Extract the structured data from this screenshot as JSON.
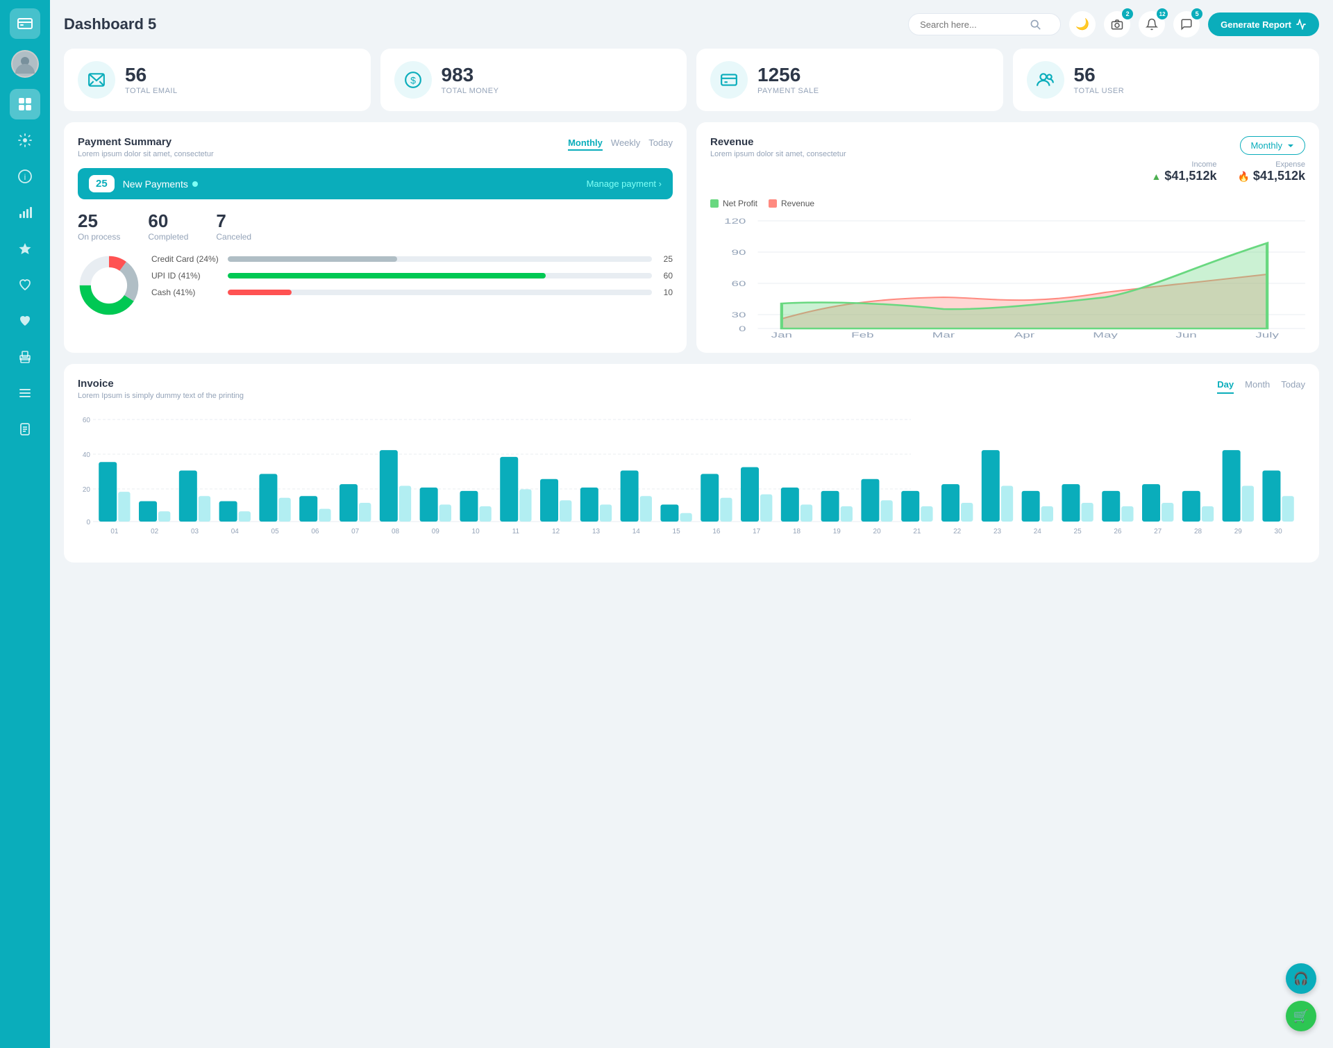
{
  "sidebar": {
    "logo_icon": "💳",
    "items": [
      {
        "id": "avatar",
        "icon": "👤",
        "active": false
      },
      {
        "id": "dashboard",
        "icon": "⊞",
        "active": true
      },
      {
        "id": "settings",
        "icon": "⚙",
        "active": false
      },
      {
        "id": "info",
        "icon": "ℹ",
        "active": false
      },
      {
        "id": "chart",
        "icon": "📊",
        "active": false
      },
      {
        "id": "star",
        "icon": "★",
        "active": false
      },
      {
        "id": "heart",
        "icon": "♥",
        "active": false
      },
      {
        "id": "heart2",
        "icon": "❤",
        "active": false
      },
      {
        "id": "print",
        "icon": "🖨",
        "active": false
      },
      {
        "id": "list",
        "icon": "≡",
        "active": false
      },
      {
        "id": "doc",
        "icon": "📄",
        "active": false
      }
    ]
  },
  "header": {
    "title": "Dashboard 5",
    "search_placeholder": "Search here...",
    "badge_camera": "2",
    "badge_bell": "12",
    "badge_chat": "5",
    "generate_btn": "Generate Report"
  },
  "stats": [
    {
      "id": "email",
      "number": "56",
      "label": "TOTAL EMAIL",
      "icon": "📋"
    },
    {
      "id": "money",
      "number": "983",
      "label": "TOTAL MONEY",
      "icon": "$"
    },
    {
      "id": "payment",
      "number": "1256",
      "label": "PAYMENT SALE",
      "icon": "💳"
    },
    {
      "id": "user",
      "number": "56",
      "label": "TOTAL USER",
      "icon": "👥"
    }
  ],
  "payment_summary": {
    "title": "Payment Summary",
    "subtitle": "Lorem ipsum dolor sit amet, consectetur",
    "tabs": [
      "Monthly",
      "Weekly",
      "Today"
    ],
    "active_tab": "Monthly",
    "new_payments_count": "25",
    "new_payments_label": "New Payments",
    "manage_payment": "Manage payment",
    "on_process": "25",
    "on_process_label": "On process",
    "completed": "60",
    "completed_label": "Completed",
    "canceled": "7",
    "canceled_label": "Canceled",
    "breakdown": [
      {
        "label": "Credit Card (24%)",
        "value": 25,
        "percent": 24,
        "color": "#b0bec5"
      },
      {
        "label": "UPI ID (41%)",
        "value": 60,
        "percent": 41,
        "color": "#00c853"
      },
      {
        "label": "Cash (41%)",
        "value": 10,
        "percent": 10,
        "color": "#ff5252"
      }
    ]
  },
  "revenue": {
    "title": "Revenue",
    "subtitle": "Lorem ipsum dolor sit amet, consectetur",
    "active_tab": "Monthly",
    "income_label": "Income",
    "income_value": "$41,512k",
    "expense_label": "Expense",
    "expense_value": "$41,512k",
    "legend": [
      {
        "label": "Net Profit",
        "color": "#69d880"
      },
      {
        "label": "Revenue",
        "color": "#ff8a80"
      }
    ],
    "months": [
      "Jan",
      "Feb",
      "Mar",
      "Apr",
      "May",
      "Jun",
      "July"
    ],
    "y_labels": [
      "120",
      "90",
      "60",
      "30",
      "0"
    ],
    "net_profit_data": [
      28,
      30,
      22,
      25,
      35,
      60,
      95
    ],
    "revenue_data": [
      10,
      28,
      35,
      20,
      40,
      50,
      60
    ]
  },
  "invoice": {
    "title": "Invoice",
    "subtitle": "Lorem Ipsum is simply dummy text of the printing",
    "active_tab": "Day",
    "tabs": [
      "Day",
      "Month",
      "Today"
    ],
    "y_labels": [
      "60",
      "40",
      "20",
      "0"
    ],
    "x_labels": [
      "01",
      "02",
      "03",
      "04",
      "05",
      "06",
      "07",
      "08",
      "09",
      "10",
      "11",
      "12",
      "13",
      "14",
      "15",
      "16",
      "17",
      "18",
      "19",
      "20",
      "21",
      "22",
      "23",
      "24",
      "25",
      "26",
      "27",
      "28",
      "29",
      "30"
    ],
    "bar_data": [
      35,
      12,
      30,
      12,
      28,
      15,
      22,
      42,
      20,
      18,
      38,
      25,
      20,
      30,
      10,
      28,
      32,
      20,
      18,
      25,
      18,
      22,
      42,
      18,
      22,
      18,
      22,
      18,
      42,
      30
    ]
  },
  "fabs": [
    {
      "id": "headset",
      "icon": "🎧",
      "color": "#0aadbb"
    },
    {
      "id": "cart",
      "icon": "🛒",
      "color": "#2dc653"
    }
  ]
}
